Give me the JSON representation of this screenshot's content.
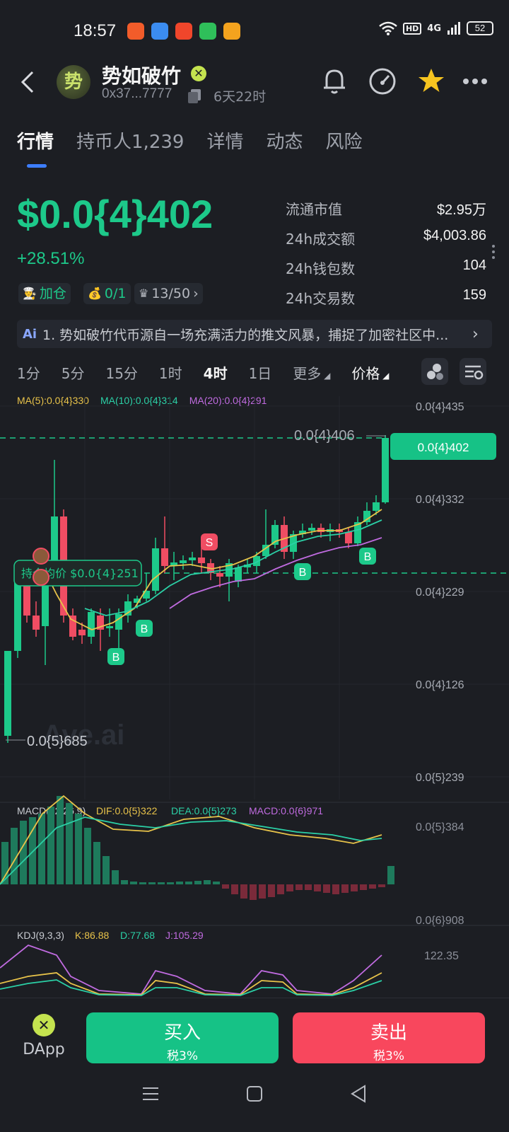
{
  "status": {
    "time": "18:57",
    "hd": "HD",
    "network": "4G",
    "battery": "52"
  },
  "header": {
    "avatar_glyph": "势",
    "token_name": "势如破竹",
    "address": "0x37...7777",
    "age": "6天22时"
  },
  "tabs": [
    {
      "label": "行情"
    },
    {
      "label": "持币人1,239"
    },
    {
      "label": "详情"
    },
    {
      "label": "动态"
    },
    {
      "label": "风险"
    }
  ],
  "price": {
    "value": "$0.0{4}402",
    "change": "+28.51%"
  },
  "chips": {
    "add": "加仓",
    "ratio": "0/1",
    "rank": "13/50"
  },
  "stats": [
    {
      "label": "流通市值",
      "value": "$2.95万"
    },
    {
      "label": "24h成交额",
      "value": "$4,003.86"
    },
    {
      "label": "24h钱包数",
      "value": "104"
    },
    {
      "label": "24h交易数",
      "value": "159"
    }
  ],
  "ai_banner": {
    "icon": "Ai",
    "text": "1. 势如破竹代币源自一场充满活力的推文风暴，捕捉了加密社区中..."
  },
  "intervals": [
    "1分",
    "5分",
    "15分",
    "1时",
    "4时",
    "1日",
    "更多",
    "价格"
  ],
  "ma_legend": {
    "ma5": "MA(5):0.0{4}330",
    "ma10": "MA(10):0.0{4}314",
    "ma20": "MA(20):0.0{4}291"
  },
  "chart": {
    "y_labels": [
      "0.0{4}435",
      "0.0{4}332",
      "0.0{4}229",
      "0.0{4}126",
      "0.0{5}239"
    ],
    "current_price_tag": "0.0{4}402",
    "high_label": "0.0{4}406",
    "low_label": "0.0{5}685",
    "avg_cost": "持仓均价 $0.0{4}251",
    "watermark": "Ave.ai",
    "markers": [
      "B",
      "B",
      "S",
      "B",
      "B"
    ],
    "colors": {
      "up": "#1dc98a",
      "down": "#f04d63",
      "ma5": "#e8c34a",
      "ma10": "#2bd0a6",
      "ma20": "#c06be0"
    }
  },
  "macd": {
    "title": "MACD(12,26,9)",
    "dif": "DIF:0.0{5}322",
    "dea": "DEA:0.0{5}273",
    "macd": "MACD:0.0{6}971",
    "y_top": "0.0{5}384",
    "y_bottom": "0.0{6}908"
  },
  "kdj": {
    "title": "KDJ(9,3,3)",
    "k": "K:86.88",
    "d": "D:77.68",
    "j": "J:105.29",
    "y_top": "122.35"
  },
  "bottom": {
    "dapp_label": "DApp",
    "buy_label": "买入",
    "buy_tax": "税3%",
    "sell_label": "卖出",
    "sell_tax": "税3%"
  }
}
